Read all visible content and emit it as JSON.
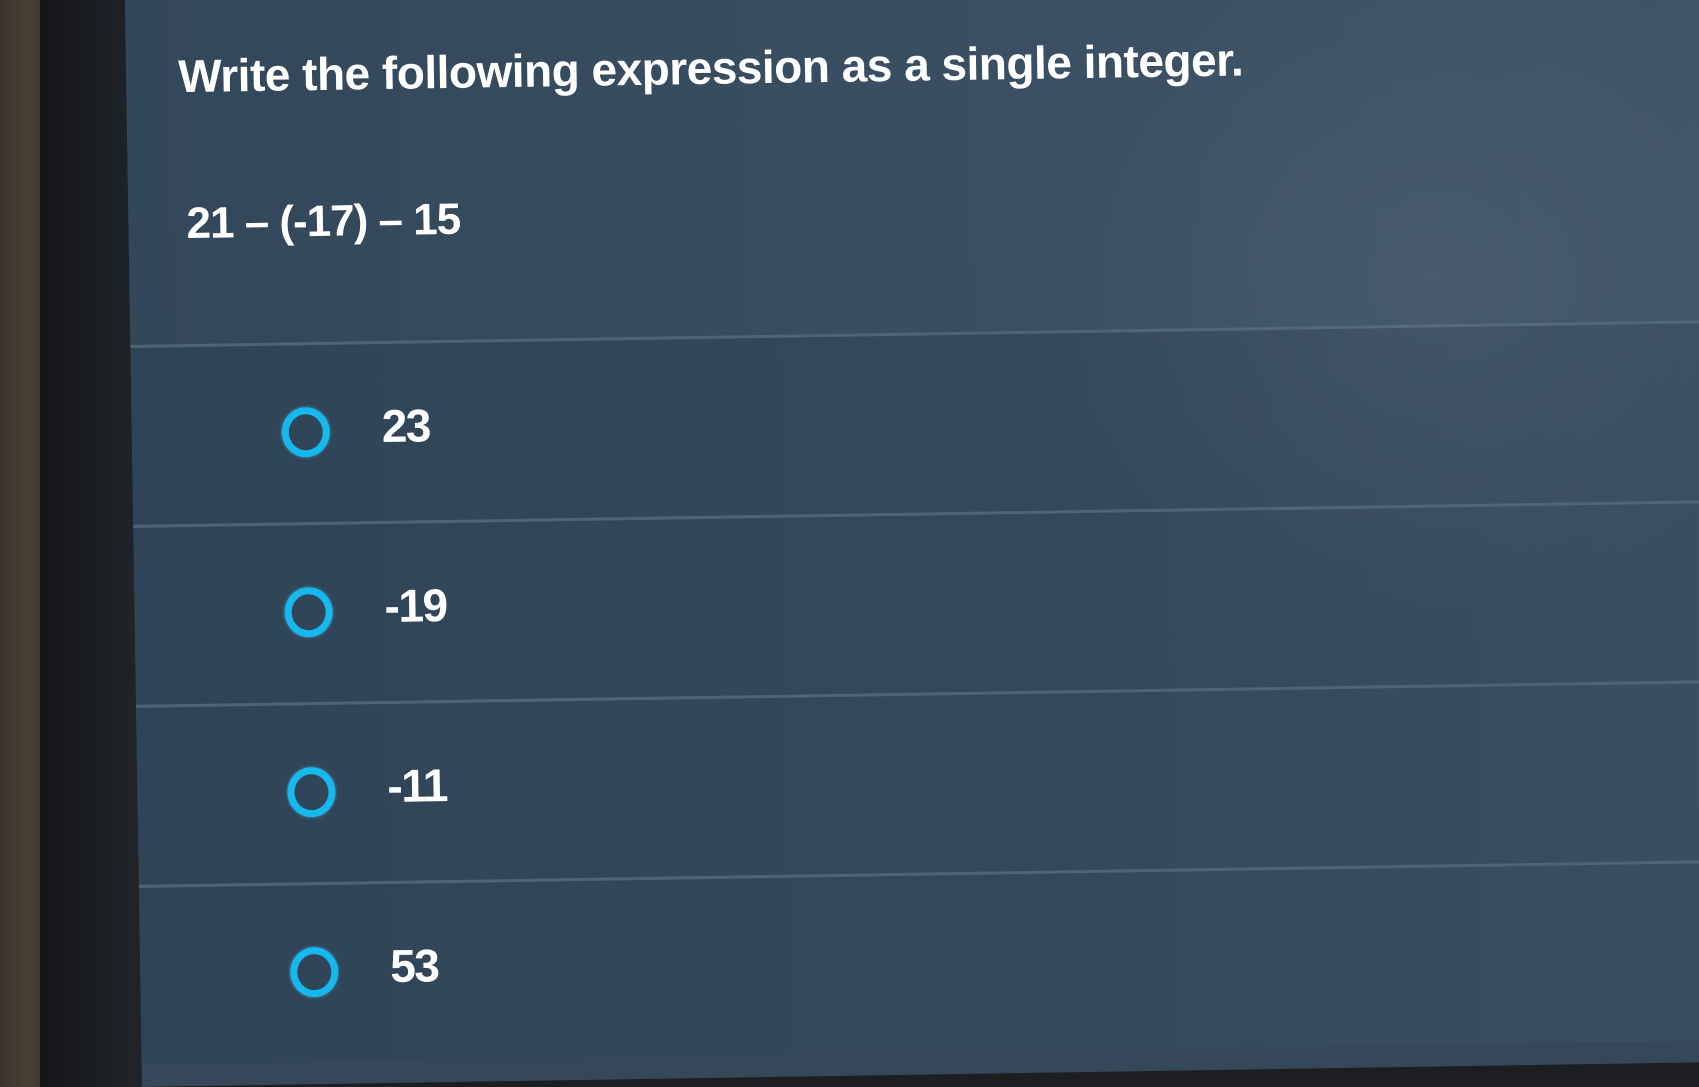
{
  "question": {
    "prompt": "Write the following expression as a single integer.",
    "expression": "21 – (-17) – 15"
  },
  "options": [
    {
      "label": "23",
      "selected": false
    },
    {
      "label": "-19",
      "selected": false
    },
    {
      "label": "-11",
      "selected": false
    },
    {
      "label": "53",
      "selected": false
    }
  ],
  "colors": {
    "background": "#35495b",
    "radio_accent": "#16b9ee",
    "text": "#ffffff",
    "divider": "#4e6477"
  }
}
